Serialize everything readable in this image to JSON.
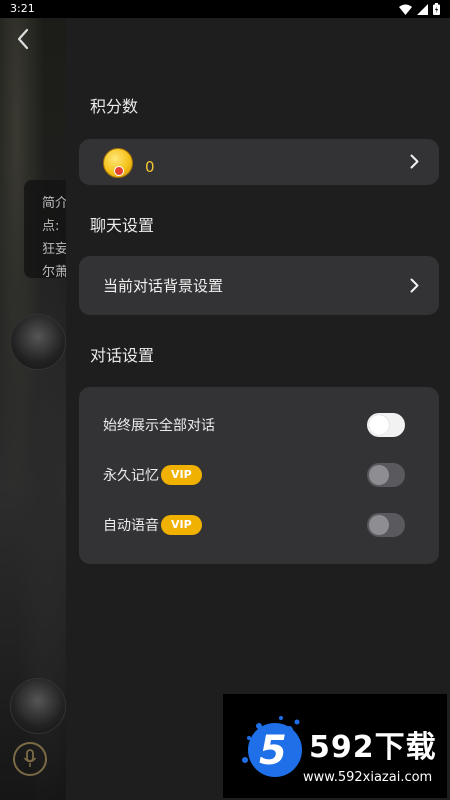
{
  "status_bar": {
    "time": "3:21",
    "icons": [
      "wifi-icon",
      "signal-icon",
      "battery-icon"
    ]
  },
  "background_chat": {
    "intro_lines": [
      "简介",
      "点:",
      "狂妄",
      "尔萧"
    ]
  },
  "points_section": {
    "title": "积分数",
    "value": "0"
  },
  "chat_settings": {
    "title": "聊天设置",
    "background_label": "当前对话背景设置"
  },
  "dialog_settings": {
    "title": "对话设置",
    "items": [
      {
        "label": "始终展示全部对话",
        "vip": "",
        "enabled": true
      },
      {
        "label": "永久记忆",
        "vip": "VIP",
        "enabled": false
      },
      {
        "label": "自动语音",
        "vip": "VIP",
        "enabled": false
      }
    ]
  },
  "watermark": {
    "logo_number": "5",
    "title": "592下载",
    "url": "www.592xiazai.com"
  },
  "colors": {
    "drawer_bg": "#1e1e1e",
    "card_bg": "#333336",
    "accent_gold": "#f0b100",
    "points_text": "#f0c432"
  }
}
